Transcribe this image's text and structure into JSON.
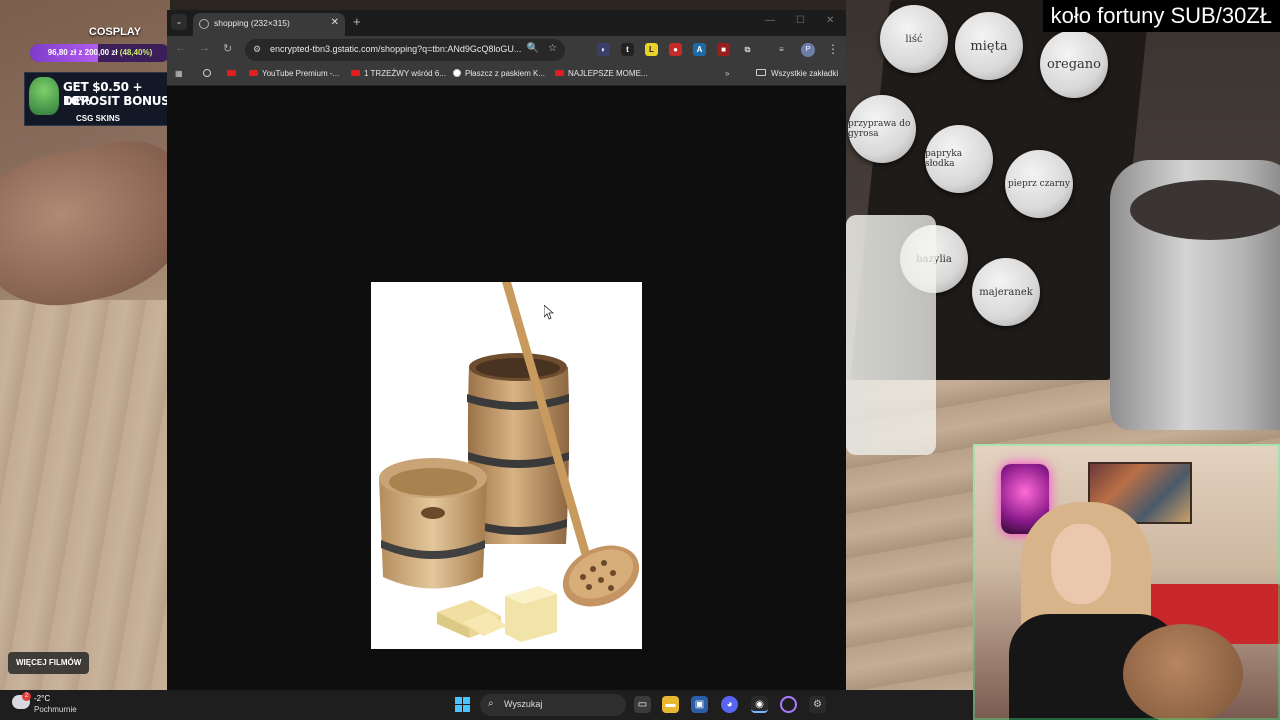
{
  "overlay": {
    "goal_title": "COSPLAY",
    "goal_amount": "96,80 zł z 200,00 zł",
    "goal_percent": "(48,40%)",
    "goal_progress": 0.484,
    "promo_line1": "GET $0.50 + 10%",
    "promo_line2": "DEPOSIT BONUS",
    "promo_brand": "CSG SKINS",
    "more_videos": "WIĘCEJ FILMÓW",
    "stream_title": "koło fortuny SUB/30ZŁ"
  },
  "scene_labels": {
    "jar1": "mięta",
    "jar2": "oregano",
    "jar3": "przyprawa do gyrosa",
    "jar4": "papryka słodka",
    "jar5": "pieprz czarny",
    "jar6": "majeranek",
    "jar7": "liść",
    "jar8": "bazylia"
  },
  "browser": {
    "tab_title": "shopping (232×315)",
    "url": "encrypted-tbn3.gstatic.com/shopping?q=tbn:ANd9GcQ8loGU...",
    "bookmarks": [
      {
        "label": ""
      },
      {
        "label": "YouTube Premium -..."
      },
      {
        "label": "1 TRZEŹWY wśród 6..."
      },
      {
        "label": "Płaszcz z paskiem K..."
      },
      {
        "label": "NAJLEPSZE MOME..."
      }
    ],
    "all_bookmarks": "Wszystkie zakładki",
    "profile_initial": "P"
  },
  "taskbar": {
    "temperature": "-2°C",
    "weather": "Pochmurnie",
    "weather_badge": "2",
    "search_placeholder": "Wyszukaj"
  },
  "colors": {
    "goal_fill": "#9b4ae0",
    "goal_percent": "#c9f06a",
    "browser_chrome": "#3a3a3a",
    "tabstrip": "#1c1c1c"
  }
}
